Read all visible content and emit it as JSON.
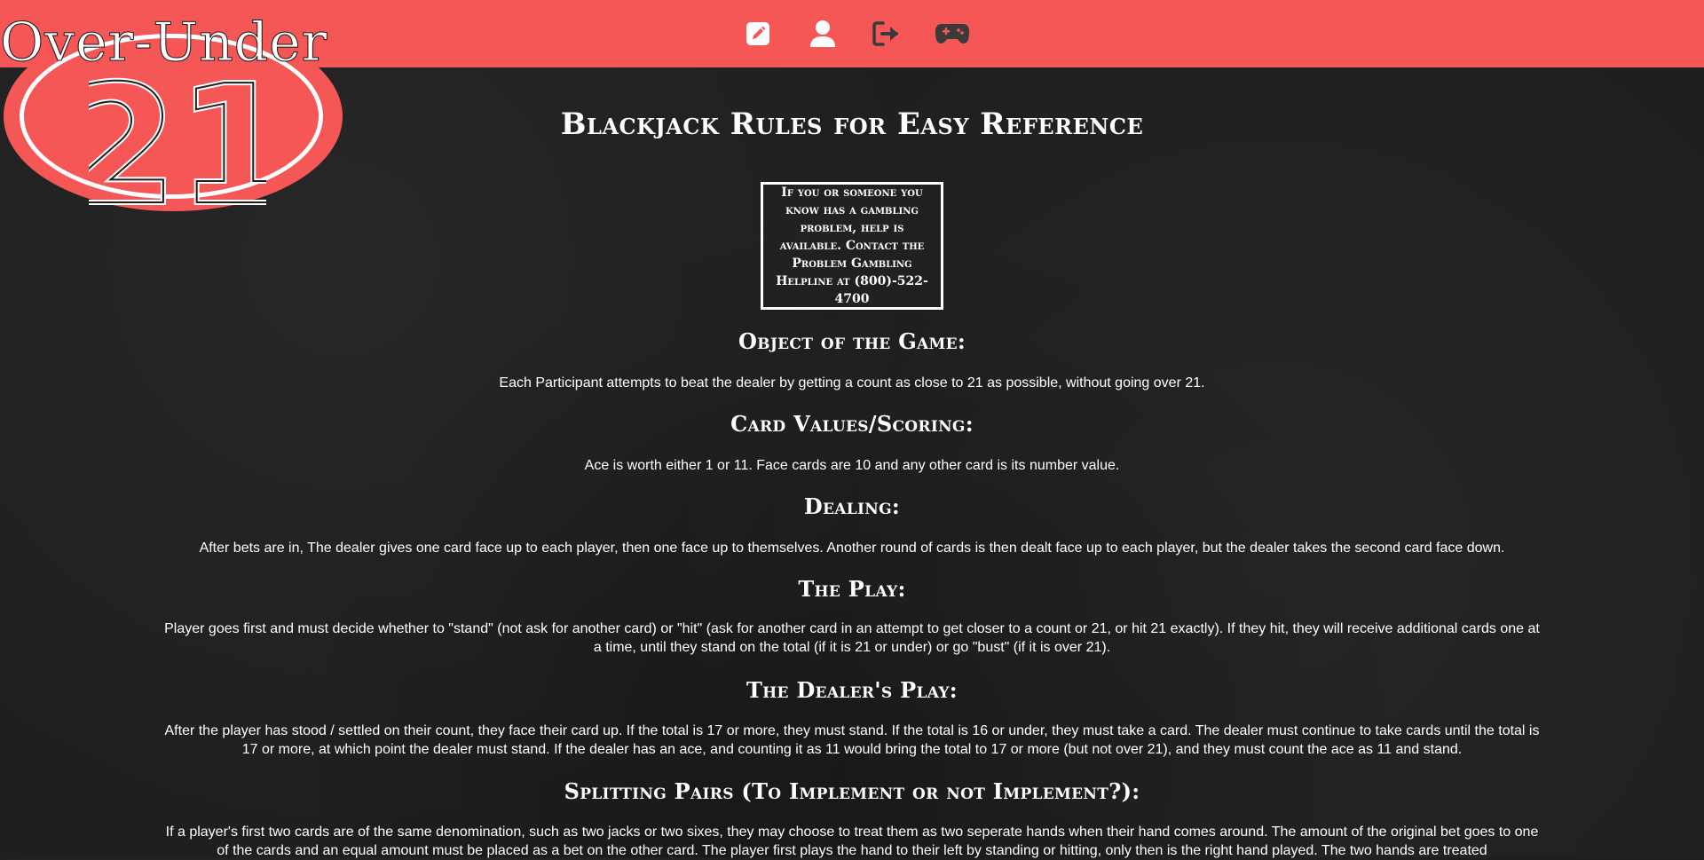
{
  "brand": {
    "name": "Over-Under",
    "number": "21",
    "color": "#f55757"
  },
  "nav": {
    "items": [
      {
        "icon": "edit-icon"
      },
      {
        "icon": "user-icon"
      },
      {
        "icon": "logout-icon"
      },
      {
        "icon": "gamepad-icon"
      }
    ]
  },
  "page": {
    "title": "Blackjack Rules for Easy Reference",
    "help_notice": "If you or someone you know has a gambling problem, help is available. Contact the Problem Gambling Helpline at (800)-522-4700"
  },
  "sections": [
    {
      "heading": "Object of the Game:",
      "text": "Each Participant attempts to beat the dealer by getting a count as close to 21 as possible, without going over 21."
    },
    {
      "heading": "Card Values/Scoring:",
      "text": "Ace is worth either 1 or 11. Face cards are 10 and any other card is its number value."
    },
    {
      "heading": "Dealing:",
      "text": "After bets are in, The dealer gives one card face up to each player, then one face up to themselves. Another round of cards is then dealt face up to each player, but the dealer takes the second card face down."
    },
    {
      "heading": "The Play:",
      "text": "Player goes first and must decide whether to \"stand\" (not ask for another card) or \"hit\" (ask for another card in an attempt to get closer to a count or 21, or hit 21 exactly). If they hit, they will receive additional cards one at a time, until they stand on the total (if it is 21 or under) or go \"bust\" (if it is over 21)."
    },
    {
      "heading": "The Dealer's Play:",
      "text": "After the player has stood / settled on their count, they face their card up. If the total is 17 or more, they must stand. If the total is 16 or under, they must take a card. The dealer must continue to take cards until the total is 17 or more, at which point the dealer must stand. If the dealer has an ace, and counting it as 11 would bring the total to 17 or more (but not over 21), and they must count the ace as 11 and stand."
    },
    {
      "heading": "Splitting Pairs (To Implement or not Implement?):",
      "text": "If a player's first two cards are of the same denomination, such as two jacks or two sixes, they may choose to treat them as two seperate hands when their hand comes around. The amount of the original bet goes to one of the cards and an equal amount must be placed as a bet on the other card. The player first plays the hand to their left by standing or hitting, only then is the right hand played. The two hands are treated"
    }
  ]
}
